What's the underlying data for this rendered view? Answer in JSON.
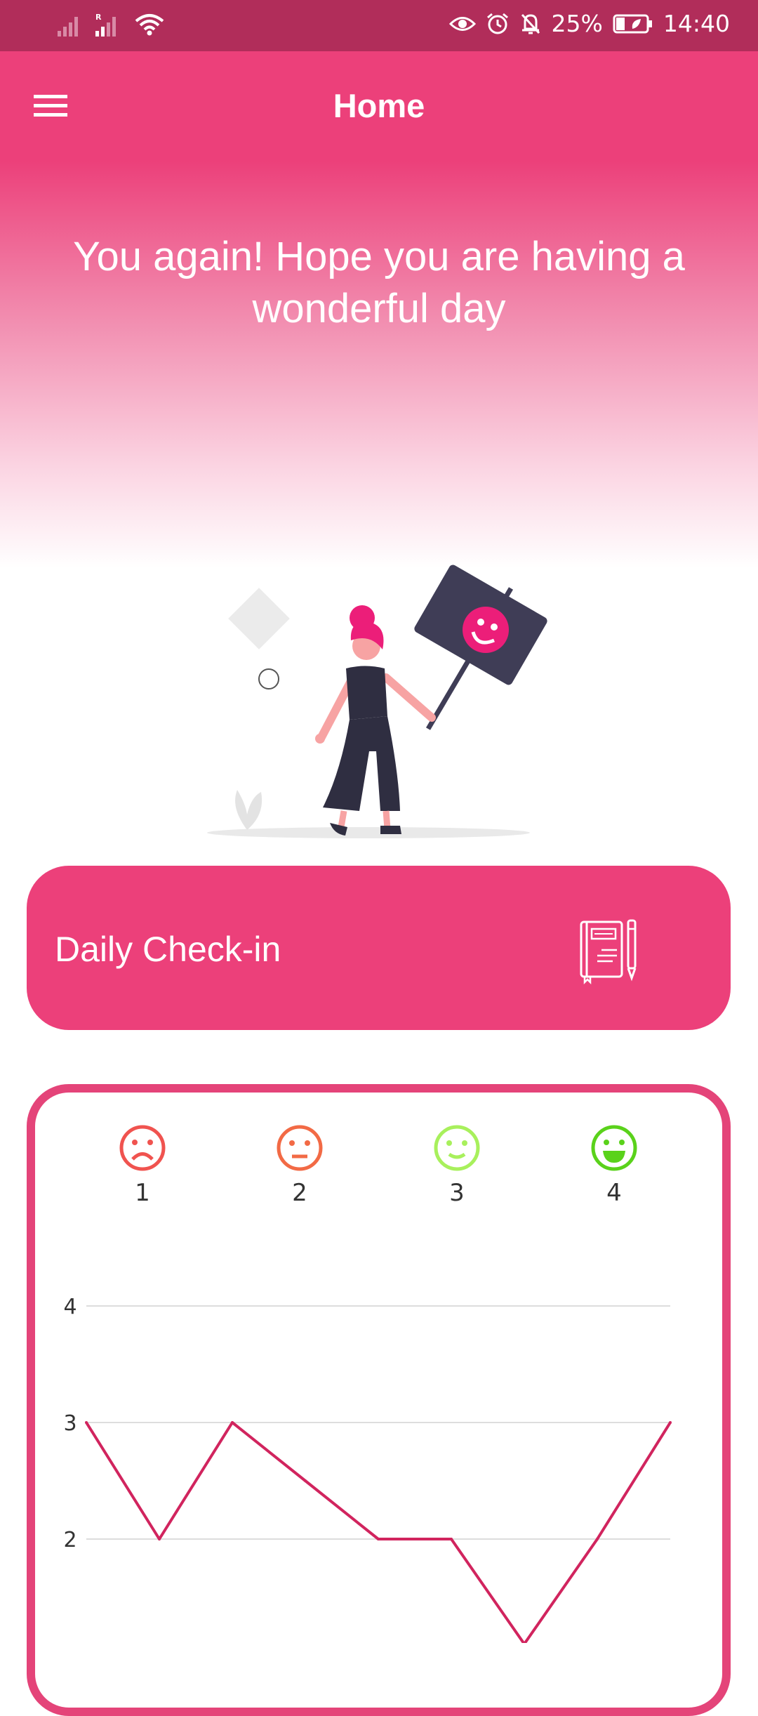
{
  "status_bar": {
    "battery": "25%",
    "time": "14:40",
    "icons": [
      "signal-icon",
      "signal-roaming-icon",
      "wifi-icon",
      "eye-icon",
      "alarm-icon",
      "bell-off-icon",
      "battery-icon"
    ]
  },
  "app_bar": {
    "title": "Home",
    "menu_icon": "hamburger-menu-icon"
  },
  "hero": {
    "message": "You again! Hope you are having a wonderful day"
  },
  "checkin": {
    "label": "Daily Check-in",
    "icon": "journal-icon"
  },
  "mood_legend": [
    {
      "icon": "very-sad-face-icon",
      "value": "1",
      "color": "#f0534f"
    },
    {
      "icon": "neutral-face-icon",
      "value": "2",
      "color": "#f26a45"
    },
    {
      "icon": "slight-smile-face-icon",
      "value": "3",
      "color": "#a8f05c"
    },
    {
      "icon": "big-smile-face-icon",
      "value": "4",
      "color": "#5ad21b"
    }
  ],
  "colors": {
    "primary": "#ec407a",
    "status_bar": "#b12d5a",
    "chart_line": "#d1245e",
    "card_border": "#e44479"
  },
  "chart_data": {
    "type": "line",
    "x": [
      0,
      1,
      2,
      3,
      4,
      5,
      6,
      7,
      8
    ],
    "series": [
      {
        "values": [
          3,
          2,
          3,
          2.5,
          2,
          2,
          1.1,
          2,
          3
        ]
      }
    ],
    "yticks": [
      "4",
      "3",
      "2"
    ],
    "ylim": [
      1,
      4
    ],
    "grid": true
  }
}
